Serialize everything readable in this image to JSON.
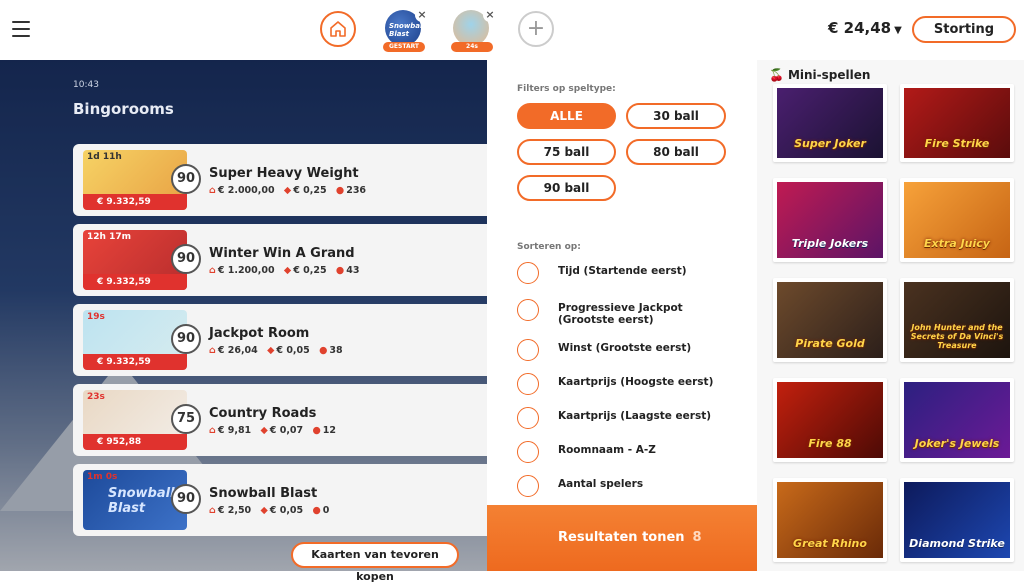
{
  "header": {
    "menu_icon": "hamburger-icon",
    "home_icon": "home-icon",
    "open_games": [
      {
        "logo": "Snowball Blast",
        "badge": "GESTART"
      },
      {
        "badge": "24s"
      }
    ],
    "add_icon": "plus-icon",
    "balance": "€ 24,48",
    "deposit_label": "Storting"
  },
  "bingo": {
    "clock": "10:43",
    "title": "Bingorooms",
    "rooms": [
      {
        "timer": "1d 11h",
        "jackpot": "€ 9.332,59",
        "balls": "90",
        "name": "Super Heavy Weight",
        "prize": "€ 2.000,00",
        "price": "€ 0,25",
        "players": "236"
      },
      {
        "timer": "12h 17m",
        "jackpot": "€ 9.332,59",
        "balls": "90",
        "name": "Winter Win A Grand",
        "prize": "€ 1.200,00",
        "price": "€ 0,25",
        "players": "43"
      },
      {
        "timer": "19s",
        "jackpot": "€ 9.332,59",
        "balls": "90",
        "name": "Jackpot Room",
        "prize": "€ 26,04",
        "price": "€ 0,05",
        "players": "38"
      },
      {
        "timer": "23s",
        "jackpot": "€ 952,88",
        "balls": "75",
        "name": "Country Roads",
        "prize": "€ 9,81",
        "price": "€ 0,07",
        "players": "12"
      },
      {
        "timer": "1m 0s",
        "logo": "Snowball Blast",
        "balls": "90",
        "name": "Snowball Blast",
        "prize": "€ 2,50",
        "price": "€ 0,05",
        "players": "0"
      }
    ],
    "prebuy_label": "Kaarten van tevoren kopen"
  },
  "filters": {
    "type_title": "Filters op speltype:",
    "types": [
      "ALLE",
      "30 ball",
      "75 ball",
      "80 ball",
      "90 ball"
    ],
    "active_type": "ALLE",
    "sort_title": "Sorteren op:",
    "sort_options": [
      "Tijd (Startende eerst)",
      "Progressieve Jackpot (Grootste eerst)",
      "Winst (Grootste eerst)",
      "Kaartprijs (Hoogste eerst)",
      "Kaartprijs (Laagste eerst)",
      "Roomnaam - A-Z",
      "Aantal spelers"
    ],
    "results_label": "Resultaten tonen",
    "results_count": "8"
  },
  "minigames": {
    "title": "Mini-spellen",
    "icon": "cherry-icon",
    "games": [
      "Super Joker",
      "Fire Strike",
      "Triple Jokers",
      "Extra Juicy",
      "Pirate Gold",
      "John Hunter and the Secrets of Da Vinci's Treasure",
      "Fire 88",
      "Joker's Jewels",
      "Great Rhino",
      "Diamond Strike"
    ]
  },
  "colors": {
    "accent": "#f26b28",
    "jackpot_red": "#e0322e"
  }
}
